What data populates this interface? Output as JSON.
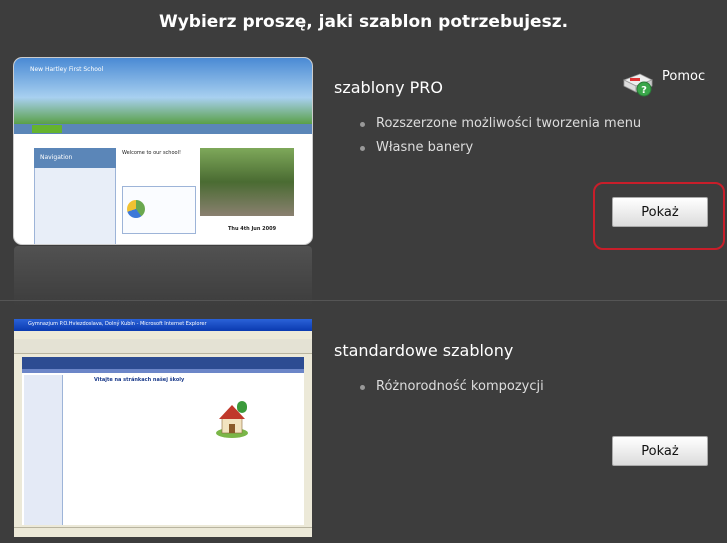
{
  "page": {
    "title": "Wybierz proszę, jaki szablon potrzebujesz."
  },
  "help": {
    "label": "Pomoc",
    "icon": "help-icon"
  },
  "sections": [
    {
      "title": "szablony PRO",
      "features": [
        "Rozszerzone możliwości tworzenia menu",
        "Własne banery"
      ],
      "button_label": "Pokaż",
      "thumbnail": {
        "site_title": "New Hartley First School",
        "welcome": "Welcome to our school!",
        "sidebar_heading": "Navigation",
        "date": "Thu 4th Jun 2009"
      }
    },
    {
      "title": "standardowe szablony",
      "features": [
        "Różnorodność kompozycji"
      ],
      "button_label": "Pokaż",
      "thumbnail": {
        "window_title": "Gymnazjum P.O.Hviezdoslava, Dolný Kubín - Microsoft Internet Explorer",
        "content_title": "Vitajte na stránkach našej školy"
      }
    }
  ],
  "colors": {
    "background": "#3d3d3d",
    "highlight": "#c81e2a"
  }
}
